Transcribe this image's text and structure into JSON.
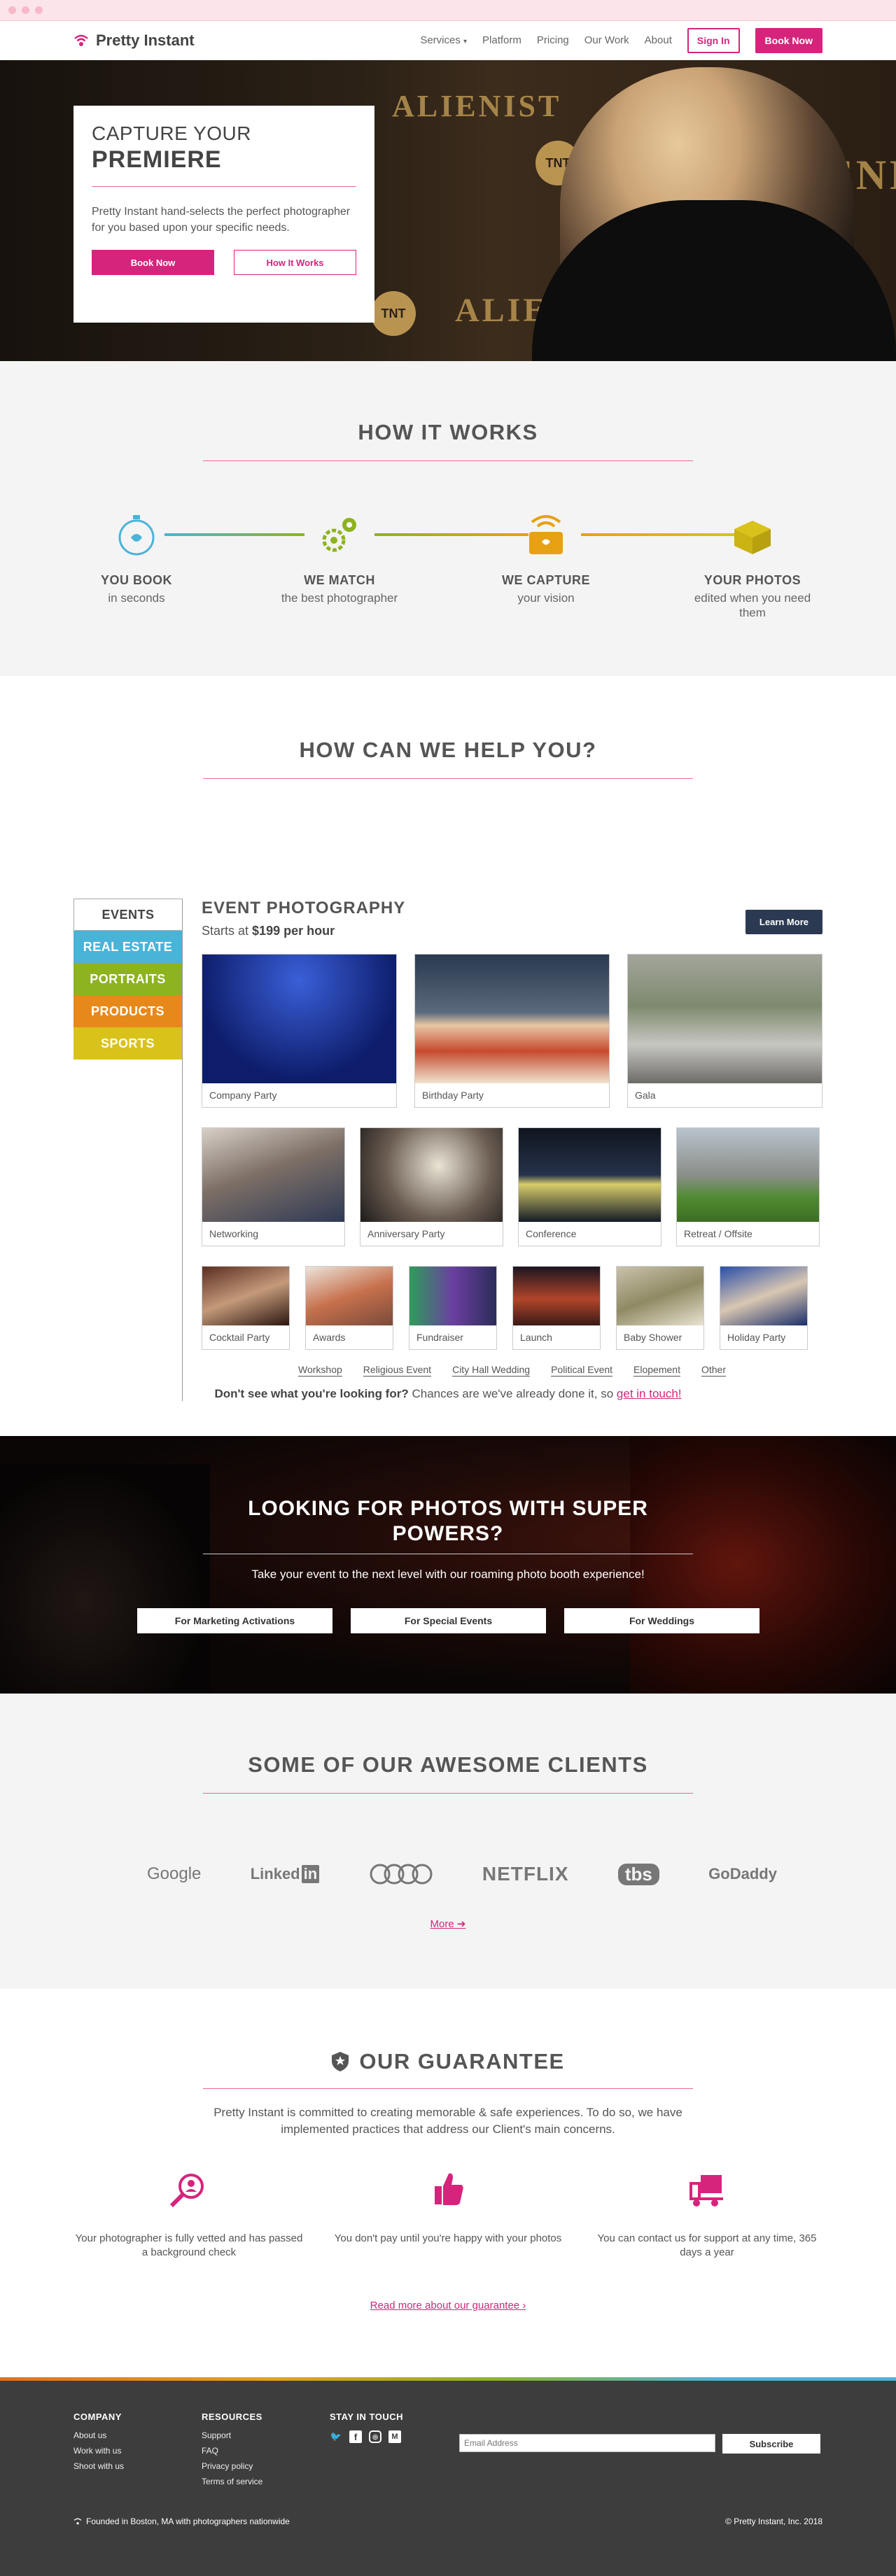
{
  "nav": {
    "brand": "Pretty Instant",
    "links": [
      "Services",
      "Platform",
      "Pricing",
      "Our Work",
      "About"
    ],
    "signin": "Sign In",
    "booknow": "Book Now"
  },
  "hero": {
    "line1": "CAPTURE YOUR",
    "line2": "PREMIERE",
    "desc": "Pretty Instant hand-selects the perfect photographer for you based upon your specific needs.",
    "btn_book": "Book Now",
    "btn_how": "How It Works",
    "bg_text": "ALIENIST",
    "bg_logo": "TNT"
  },
  "how": {
    "title": "HOW IT WORKS",
    "steps": [
      {
        "title": "YOU BOOK",
        "sub": "in seconds",
        "icon": "stopwatch-icon",
        "color": "#4ab3d8"
      },
      {
        "title": "WE MATCH",
        "sub": "the best photographer",
        "icon": "gears-icon",
        "color": "#8db31f"
      },
      {
        "title": "WE CAPTURE",
        "sub": "your vision",
        "icon": "camera-icon",
        "color": "#e7a112"
      },
      {
        "title": "YOUR PHOTOS",
        "sub": "edited when you need them",
        "icon": "box-icon",
        "color": "#d9c21a"
      }
    ]
  },
  "help": {
    "title": "HOW CAN WE HELP YOU?",
    "tabs": [
      {
        "label": "EVENTS",
        "color": "#ffffff"
      },
      {
        "label": "REAL ESTATE",
        "color": "#4ab3d8"
      },
      {
        "label": "PORTRAITS",
        "color": "#8db31f"
      },
      {
        "label": "PRODUCTS",
        "color": "#e7891a"
      },
      {
        "label": "SPORTS",
        "color": "#d9c21a"
      }
    ],
    "category": "EVENT PHOTOGRAPHY",
    "starts_prefix": "Starts at",
    "starts_price": "$199 per hour",
    "learn_more": "Learn More",
    "row1": [
      "Company Party",
      "Birthday Party",
      "Gala"
    ],
    "row2": [
      "Networking",
      "Anniversary Party",
      "Conference",
      "Retreat / Offsite"
    ],
    "row3": [
      "Cocktail Party",
      "Awards",
      "Fundraiser",
      "Launch",
      "Baby Shower",
      "Holiday Party"
    ],
    "others": [
      "Workshop",
      "Religious Event",
      "City Hall Wedding",
      "Political Event",
      "Elopement",
      "Other"
    ],
    "touch_bold": "Don't see what you're looking for?",
    "touch_text": "Chances are we've already done it, so",
    "touch_link": "get in touch!"
  },
  "super": {
    "title": "LOOKING FOR PHOTOS WITH SUPER POWERS?",
    "desc": "Take your event to the next level with our roaming photo booth experience!",
    "buttons": [
      "For Marketing Activations",
      "For Special Events",
      "For Weddings"
    ]
  },
  "clients": {
    "title": "SOME OF OUR AWESOME CLIENTS",
    "logos": [
      "Google",
      "Linked",
      "in",
      "NETFLIX",
      "tbs",
      "GoDaddy"
    ],
    "more": "More ➔"
  },
  "guarantee": {
    "title": "OUR GUARANTEE",
    "intro": "Pretty Instant is committed to creating memorable & safe experiences. To do so, we have implemented practices that address our Client's main concerns.",
    "items": [
      {
        "text": "Your photographer is fully vetted and has passed a background check",
        "icon": "magnifier-person-icon"
      },
      {
        "text": "You don't pay until you're happy with your photos",
        "icon": "thumbs-up-icon"
      },
      {
        "text": "You can contact us for support at any time, 365 days a year",
        "icon": "support-truck-icon"
      }
    ],
    "read_more": "Read more about our guarantee ›"
  },
  "footer": {
    "company_title": "COMPANY",
    "company": [
      "About us",
      "Work with us",
      "Shoot with us"
    ],
    "resources_title": "RESOURCES",
    "resources": [
      "Support",
      "FAQ",
      "Privacy policy",
      "Terms of service"
    ],
    "touch_title": "STAY IN TOUCH",
    "email_placeholder": "Email Address",
    "subscribe": "Subscribe",
    "founded": "Founded in Boston, MA with photographers nationwide",
    "copyright": "© Pretty Instant, Inc. 2018"
  }
}
